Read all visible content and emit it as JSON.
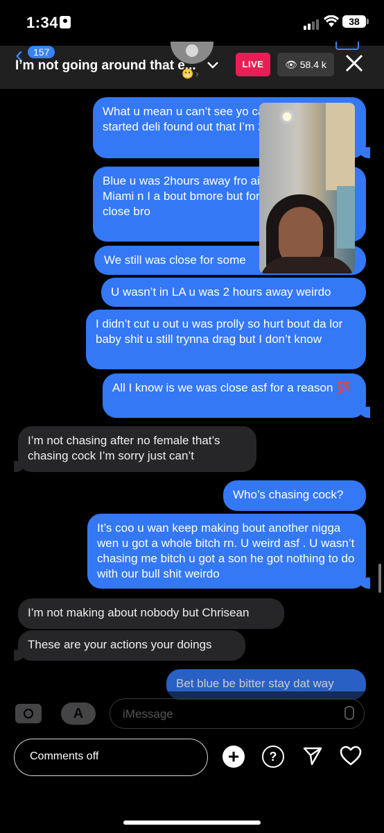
{
  "status_bar": {
    "time": "1:34",
    "battery": "38"
  },
  "header": {
    "back_count": "157",
    "title": "I’m not going around that e...",
    "live_label": "LIVE",
    "viewers": "58.4 k",
    "emoji": "😬"
  },
  "messages": [
    {
      "dir": "out",
      "text": "What u mean u can’t see yo calling u befor I started deli found out that I’m 2cm dial"
    },
    {
      "dir": "out",
      "text": "Blue u was 2hours away fro ain’t tell me bout Miami n I a bout bmore but for some re had us close bro"
    },
    {
      "dir": "out",
      "text": "We still was close for some"
    },
    {
      "dir": "out",
      "text": "U wasn’t in LA u was 2 hours away weirdo"
    },
    {
      "dir": "out",
      "text": "I didn’t cut u out u was prolly so hurt bout da lor baby shit u still trynna drag but I don’t know"
    },
    {
      "dir": "out",
      "text": "All I know is we was close asf for a reason 💯"
    },
    {
      "dir": "in",
      "text": "I’m not chasing after no female that’s chasing cock I’m sorry just can’t"
    },
    {
      "dir": "out",
      "text": "Who’s chasing cock?"
    },
    {
      "dir": "out",
      "text": "It’s coo u wan keep making bout another nigga wen u got a whole bitch rn. U weird asf . U wasn’t chasing me bitch u got a son he got nothing to do with our bull shit weirdo"
    },
    {
      "dir": "in",
      "text": "I’m not making about nobody but Chrisean"
    },
    {
      "dir": "in",
      "text": "These are your actions your doings"
    },
    {
      "dir": "out",
      "text": "Bet blue be bitter stay dat way"
    }
  ],
  "composer": {
    "placeholder": "iMessage",
    "store_glyph": "A"
  },
  "footer": {
    "comments_label": "Comments off",
    "plus_glyph": "+",
    "question_glyph": "?"
  },
  "colors": {
    "outgoing": "#3478f6",
    "incoming": "#262628",
    "live": "#ec1d54",
    "accent": "#3a82f7"
  }
}
